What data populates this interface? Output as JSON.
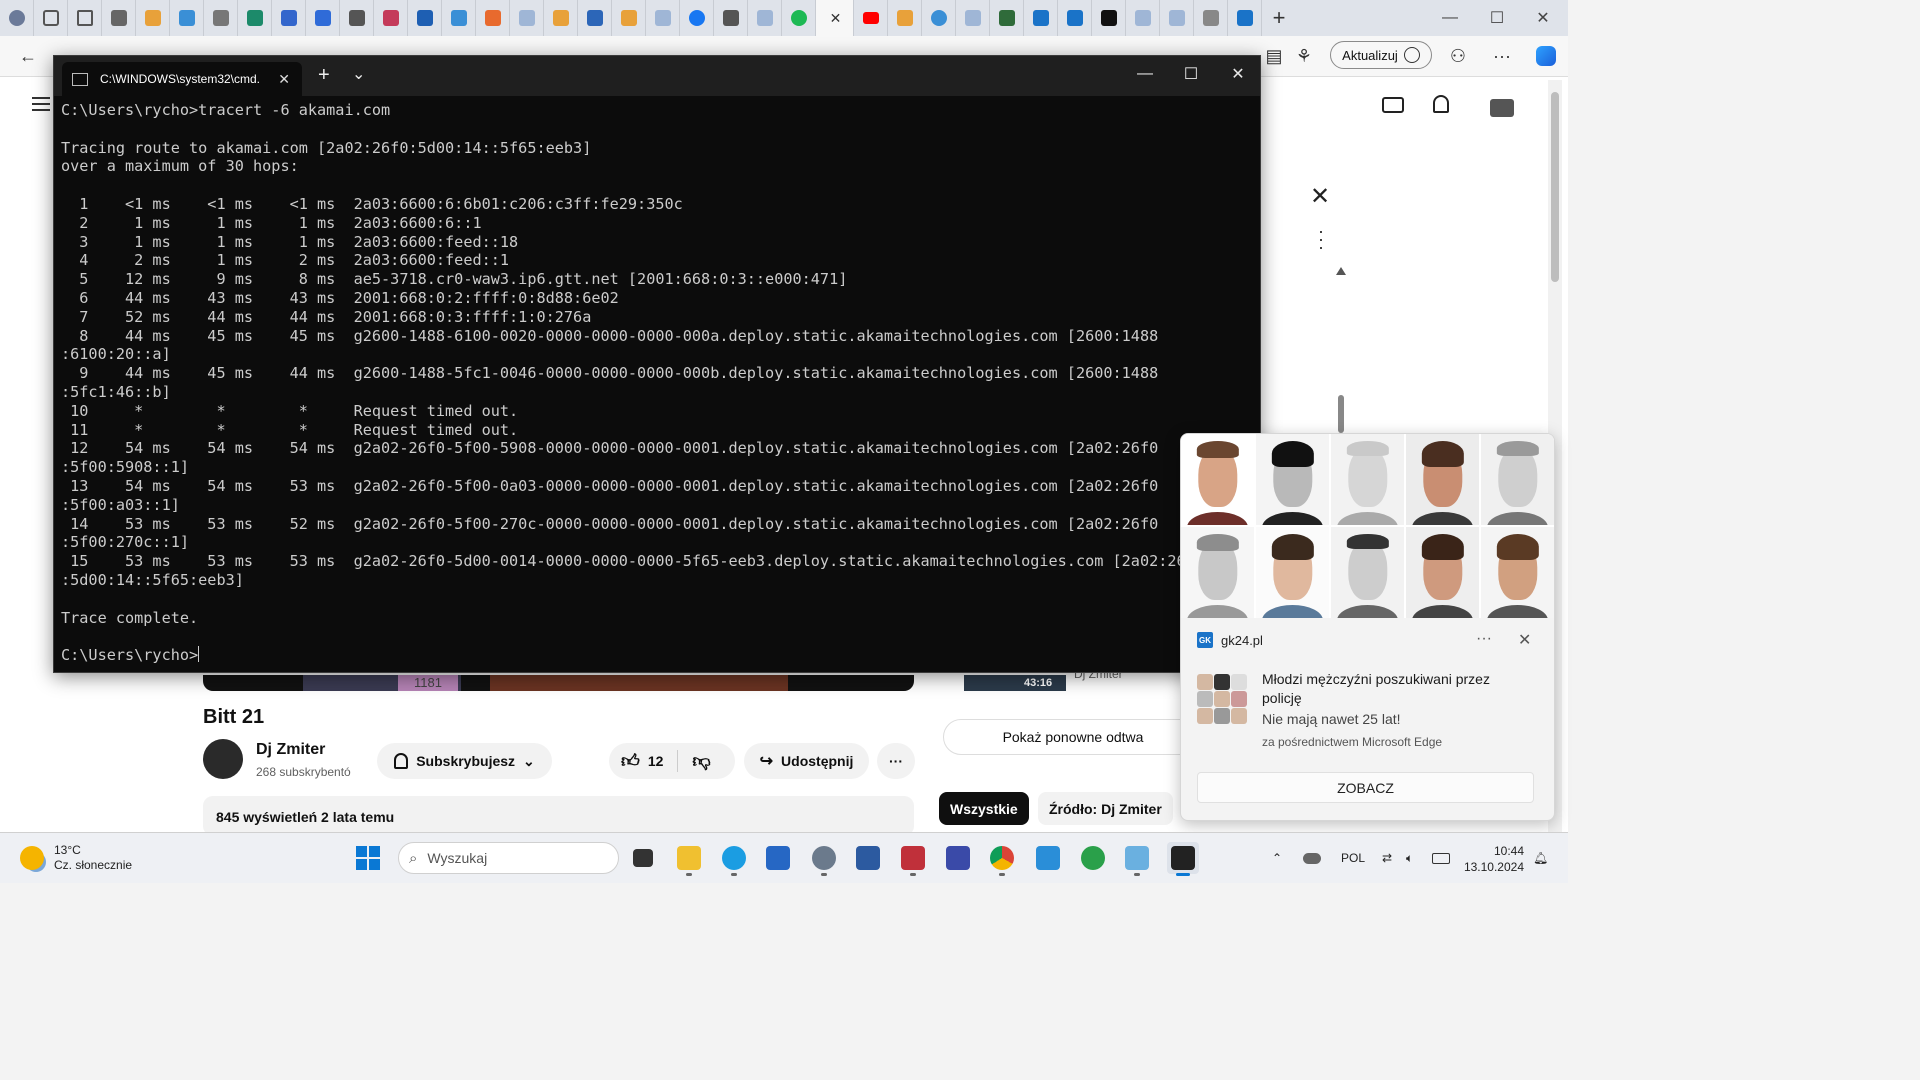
{
  "browser": {
    "tabs_count": 36,
    "active_tab_close": "✕",
    "update_button": "Aktualizuj",
    "new_tab": "+"
  },
  "terminal": {
    "tab_title": "C:\\WINDOWS\\system32\\cmd.",
    "new_tab": "+",
    "dropdown": "⌄",
    "lines": [
      "C:\\Users\\rycho>tracert -6 akamai.com",
      "",
      "Tracing route to akamai.com [2a02:26f0:5d00:14::5f65:eeb3]",
      "over a maximum of 30 hops:",
      "",
      "  1    <1 ms    <1 ms    <1 ms  2a03:6600:6:6b01:c206:c3ff:fe29:350c",
      "  2     1 ms     1 ms     1 ms  2a03:6600:6::1",
      "  3     1 ms     1 ms     1 ms  2a03:6600:feed::18",
      "  4     2 ms     1 ms     2 ms  2a03:6600:feed::1",
      "  5    12 ms     9 ms     8 ms  ae5-3718.cr0-waw3.ip6.gtt.net [2001:668:0:3::e000:471]",
      "  6    44 ms    43 ms    43 ms  2001:668:0:2:ffff:0:8d88:6e02",
      "  7    52 ms    44 ms    44 ms  2001:668:0:3:ffff:1:0:276a",
      "  8    44 ms    45 ms    45 ms  g2600-1488-6100-0020-0000-0000-0000-000a.deploy.static.akamaitechnologies.com [2600:1488",
      ":6100:20::a]",
      "  9    44 ms    45 ms    44 ms  g2600-1488-5fc1-0046-0000-0000-0000-000b.deploy.static.akamaitechnologies.com [2600:1488",
      ":5fc1:46::b]",
      " 10     *        *        *     Request timed out.",
      " 11     *        *        *     Request timed out.",
      " 12    54 ms    54 ms    54 ms  g2a02-26f0-5f00-5908-0000-0000-0000-0001.deploy.static.akamaitechnologies.com [2a02:26f0",
      ":5f00:5908::1]",
      " 13    54 ms    54 ms    53 ms  g2a02-26f0-5f00-0a03-0000-0000-0000-0001.deploy.static.akamaitechnologies.com [2a02:26f0",
      ":5f00:a03::1]",
      " 14    53 ms    53 ms    52 ms  g2a02-26f0-5f00-270c-0000-0000-0000-0001.deploy.static.akamaitechnologies.com [2a02:26f0",
      ":5f00:270c::1]",
      " 15    53 ms    53 ms    53 ms  g2a02-26f0-5d00-0014-0000-0000-0000-5f65-eeb3.deploy.static.akamaitechnologies.com [2a02:26f0",
      ":5d00:14::5f65:eeb3]",
      "",
      "Trace complete.",
      ""
    ],
    "prompt": "C:\\Users\\rycho>"
  },
  "youtube": {
    "video_title": "Bitt 21",
    "channel_name": "Dj Zmiter",
    "subscribers": "268 subskrybentó",
    "subscribe_button": "Subskrybujesz",
    "likes": "12",
    "share_button": "Udostępnij",
    "more_button": "···",
    "description_meta": "845 wyświetleń  2 lata temu",
    "replay_button": "Pokaż ponowne odtwa",
    "chip_all": "Wszystkie",
    "chip_source": "Źródło: Dj Zmiter",
    "video_number": "1181",
    "duration": "43:16",
    "suggested_channel": "Dj Zmiter"
  },
  "notification": {
    "source": "gk24.pl",
    "source_badge": "GK",
    "more": "···",
    "close": "✕",
    "title": "Młodzi mężczyźni poszukiwani przez policję",
    "subtitle": "Nie mają nawet 25 lat!",
    "via": "za pośrednictwem Microsoft Edge",
    "action_button": "ZOBACZ"
  },
  "taskbar": {
    "temperature": "13°C",
    "weather": "Cz. słonecznie",
    "search_placeholder": "Wyszukaj",
    "language": "POL",
    "time": "10:44",
    "date": "13.10.2024"
  }
}
